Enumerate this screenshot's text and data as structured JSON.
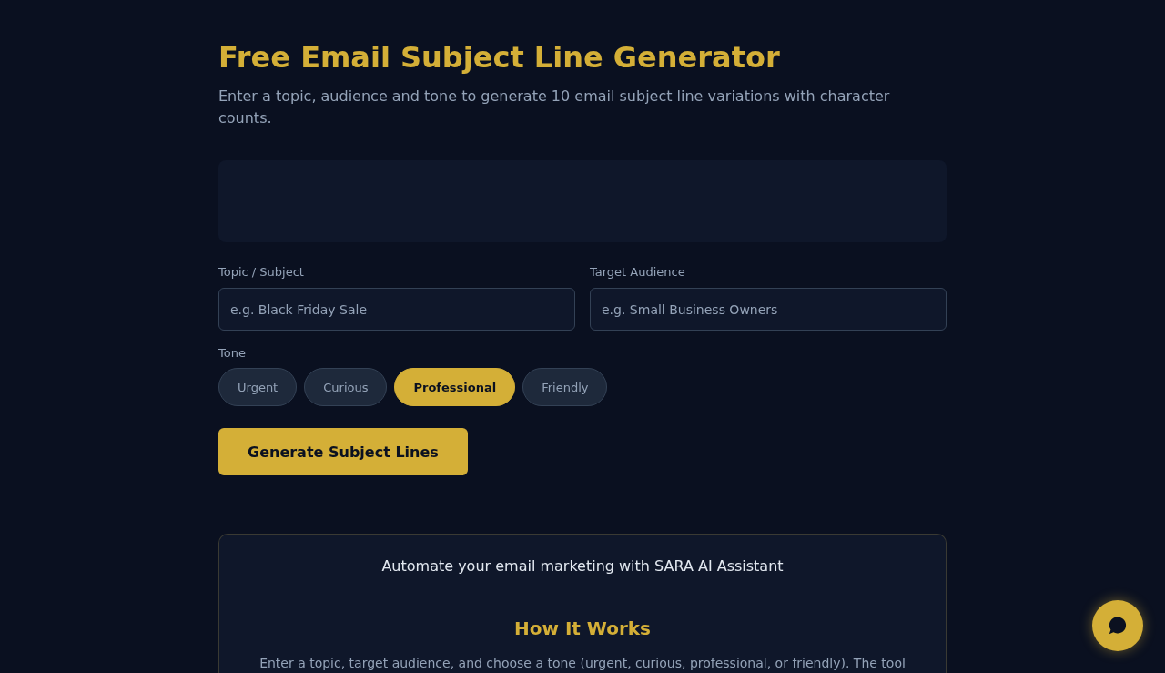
{
  "header": {
    "title": "Free Email Subject Line Generator",
    "subtitle": "Enter a topic, audience and tone to generate 10 email subject line variations with character counts."
  },
  "form": {
    "fields": [
      {
        "label": "Topic / Subject",
        "placeholder": "e.g. Black Friday Sale"
      },
      {
        "label": "Target Audience",
        "placeholder": "e.g. Small Business Owners"
      }
    ],
    "tone": {
      "label": "Tone",
      "options": [
        {
          "label": "Urgent",
          "selected": false
        },
        {
          "label": "Curious",
          "selected": false
        },
        {
          "label": "Professional",
          "selected": true
        },
        {
          "label": "Friendly",
          "selected": false
        }
      ]
    },
    "submit": "Generate Subject Lines"
  },
  "promo_card": {
    "text": "Automate your email marketing with SARA AI Assistant",
    "heading": "How It Works",
    "body": "Enter a topic, target audience, and choose a tone (urgent, curious, professional, or friendly). The tool"
  }
}
